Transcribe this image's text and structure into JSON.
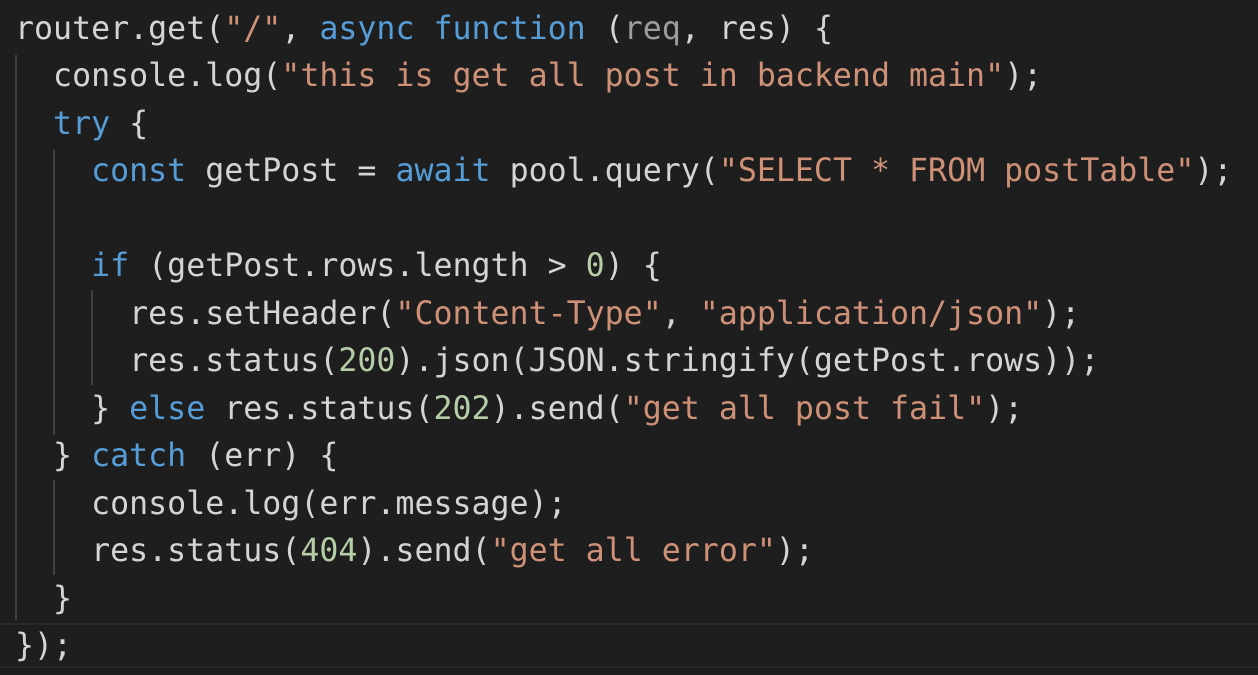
{
  "code": {
    "lines": [
      [
        {
          "t": "router.get(",
          "c": "id"
        },
        {
          "t": "\"/\"",
          "c": "str"
        },
        {
          "t": ", ",
          "c": "id"
        },
        {
          "t": "async",
          "c": "kw"
        },
        {
          "t": " ",
          "c": "id"
        },
        {
          "t": "function",
          "c": "kw"
        },
        {
          "t": " (",
          "c": "id"
        },
        {
          "t": "req",
          "c": "dim"
        },
        {
          "t": ", res) {",
          "c": "id"
        }
      ],
      [
        {
          "t": "  console.log(",
          "c": "id"
        },
        {
          "t": "\"this is get all post in backend main\"",
          "c": "str"
        },
        {
          "t": ");",
          "c": "id"
        }
      ],
      [
        {
          "t": "  ",
          "c": "id"
        },
        {
          "t": "try",
          "c": "ctl"
        },
        {
          "t": " {",
          "c": "id"
        }
      ],
      [
        {
          "t": "    ",
          "c": "id"
        },
        {
          "t": "const",
          "c": "kw"
        },
        {
          "t": " getPost = ",
          "c": "id"
        },
        {
          "t": "await",
          "c": "kw"
        },
        {
          "t": " pool.query(",
          "c": "id"
        },
        {
          "t": "\"SELECT * FROM postTable\"",
          "c": "str"
        },
        {
          "t": ");",
          "c": "id"
        }
      ],
      [],
      [
        {
          "t": "    ",
          "c": "id"
        },
        {
          "t": "if",
          "c": "ctl"
        },
        {
          "t": " (getPost.rows.length > ",
          "c": "id"
        },
        {
          "t": "0",
          "c": "num"
        },
        {
          "t": ") {",
          "c": "id"
        }
      ],
      [
        {
          "t": "      res.setHeader(",
          "c": "id"
        },
        {
          "t": "\"Content-Type\"",
          "c": "str"
        },
        {
          "t": ", ",
          "c": "id"
        },
        {
          "t": "\"application/json\"",
          "c": "str"
        },
        {
          "t": ");",
          "c": "id"
        }
      ],
      [
        {
          "t": "      res.status(",
          "c": "id"
        },
        {
          "t": "200",
          "c": "num"
        },
        {
          "t": ").json(JSON.stringify(getPost.rows));",
          "c": "id"
        }
      ],
      [
        {
          "t": "    } ",
          "c": "id"
        },
        {
          "t": "else",
          "c": "ctl"
        },
        {
          "t": " res.status(",
          "c": "id"
        },
        {
          "t": "202",
          "c": "num"
        },
        {
          "t": ").send(",
          "c": "id"
        },
        {
          "t": "\"get all post fail\"",
          "c": "str"
        },
        {
          "t": ");",
          "c": "id"
        }
      ],
      [
        {
          "t": "  } ",
          "c": "id"
        },
        {
          "t": "catch",
          "c": "ctl"
        },
        {
          "t": " (err) {",
          "c": "id"
        }
      ],
      [
        {
          "t": "    console.log(err.message);",
          "c": "id"
        }
      ],
      [
        {
          "t": "    res.status(",
          "c": "id"
        },
        {
          "t": "404",
          "c": "num"
        },
        {
          "t": ").send(",
          "c": "id"
        },
        {
          "t": "\"get all error\"",
          "c": "str"
        },
        {
          "t": ");",
          "c": "id"
        }
      ],
      [
        {
          "t": "  }",
          "c": "id"
        }
      ],
      [
        {
          "t": "});",
          "c": "id"
        }
      ]
    ]
  }
}
